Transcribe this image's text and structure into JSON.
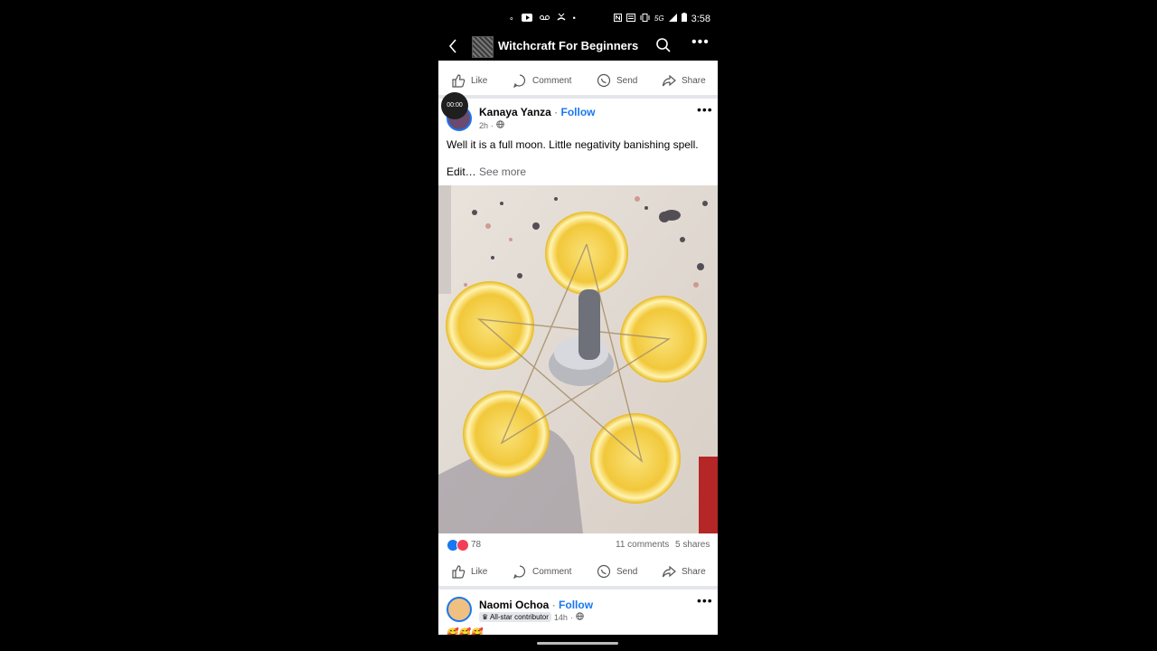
{
  "status_bar": {
    "time": "3:58",
    "network": "5G",
    "left_icons": [
      "dot-icon",
      "youtube-icon",
      "voicemail-icon",
      "missed-call-icon",
      "dot-icon"
    ],
    "right_icons": [
      "nfc-icon",
      "cast-icon",
      "vibrate-icon",
      "network-5g",
      "signal-icon",
      "battery-icon"
    ]
  },
  "app_bar": {
    "title": "Witchcraft For Beginners"
  },
  "actions": {
    "like": "Like",
    "comment": "Comment",
    "send": "Send",
    "share": "Share"
  },
  "post1": {
    "video_timer": "00:00",
    "author": "Kanaya Yanza",
    "follow": "Follow",
    "separator": " · ",
    "time": "2h",
    "text": "Well it is a full moon. Little negativity banishing spell.",
    "edit_text": "Edit…",
    "see_more": "See more",
    "reaction_count": "78",
    "comments": "11 comments",
    "shares": "5 shares",
    "reaction_colors": [
      "#1877f2",
      "#f33e58"
    ]
  },
  "post2": {
    "author": "Naomi Ochoa",
    "follow": "Follow",
    "separator": " · ",
    "badge": "All-star contributor",
    "time": "14h",
    "emoji_line": "🥰🥰🥰"
  }
}
